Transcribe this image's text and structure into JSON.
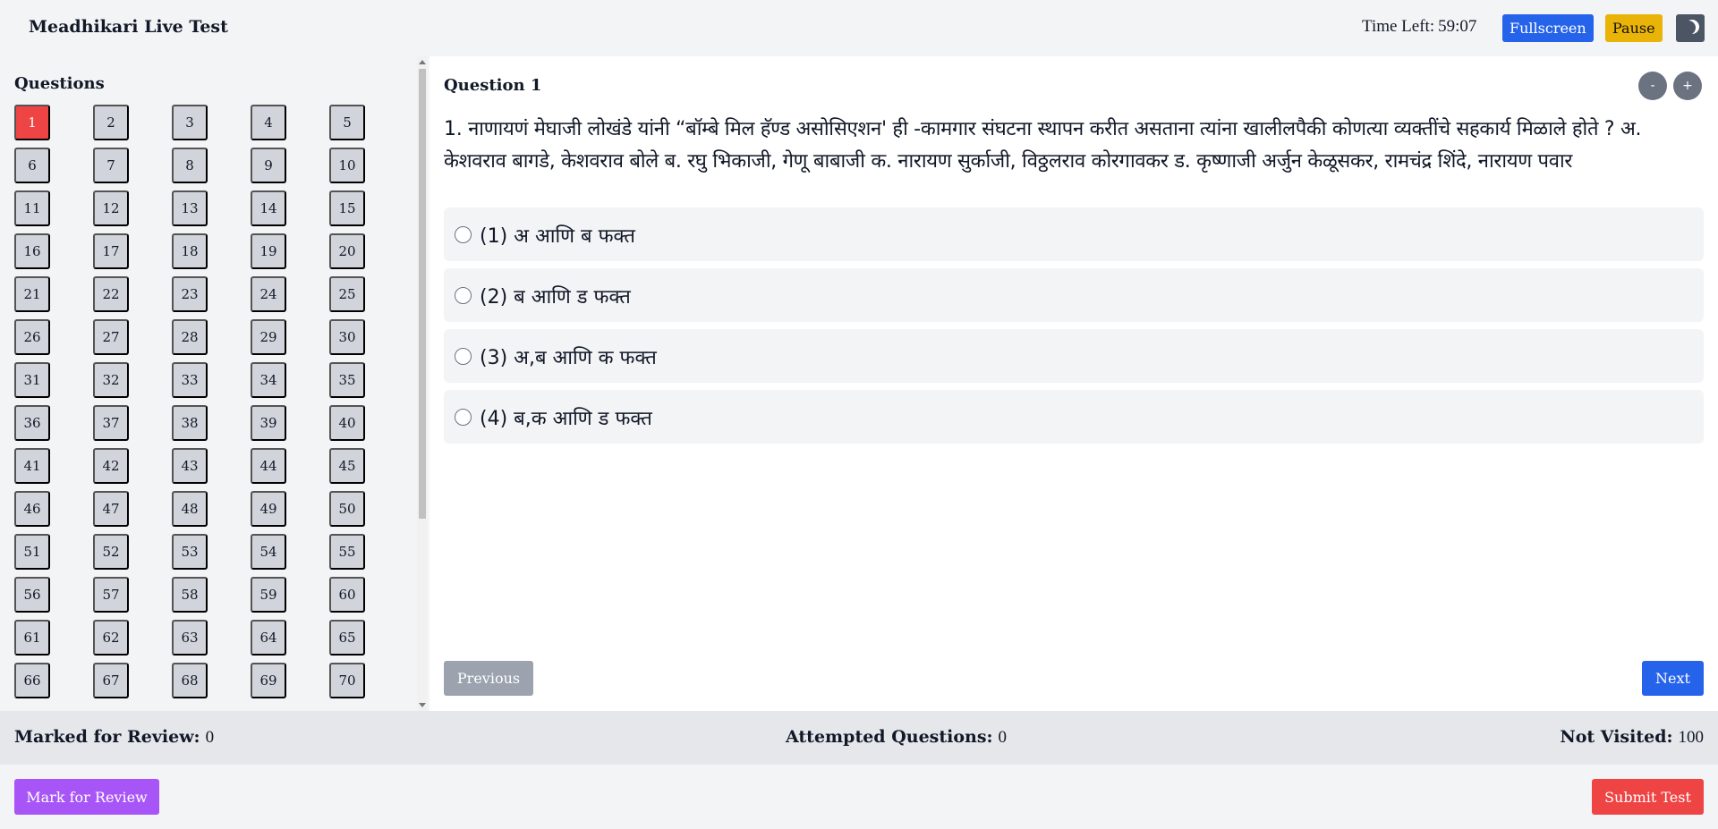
{
  "header": {
    "title": "Meadhikari Live Test",
    "time_label": "Time Left:",
    "time_value": "59:07",
    "fullscreen_label": "Fullscreen",
    "pause_label": "Pause",
    "theme_icon": "moon-icon"
  },
  "sidebar": {
    "heading": "Questions",
    "active_question": 1,
    "visible_question_numbers": [
      "1",
      "2",
      "3",
      "4",
      "5",
      "6",
      "7",
      "8",
      "9",
      "10",
      "11",
      "12",
      "13",
      "14",
      "15",
      "16",
      "17",
      "18",
      "19",
      "20",
      "21",
      "22",
      "23",
      "24",
      "25",
      "26",
      "27",
      "28",
      "29",
      "30",
      "31",
      "32",
      "33",
      "34",
      "35",
      "36",
      "37",
      "38",
      "39",
      "40",
      "41",
      "42",
      "43",
      "44",
      "45",
      "46",
      "47",
      "48",
      "49",
      "50",
      "51",
      "52",
      "53",
      "54",
      "55",
      "56",
      "57",
      "58",
      "59",
      "60",
      "61",
      "62",
      "63",
      "64",
      "65",
      "66",
      "67",
      "68",
      "69",
      "70"
    ]
  },
  "question": {
    "heading": "Question 1",
    "zoom_out_label": "-",
    "zoom_in_label": "+",
    "text": "1. नाणायणं मेघाजी लोखंडे यांनी “बॉम्बे मिल हॅण्ड असोसिएशन' ही -कामगार संघटना स्थापन करीत असताना त्यांना खालीलपैकी कोणत्या व्यक्तींचे सहकार्य मिळाले होते ? अ. केशवराव बागडे, केशवराव बोले ब. रघु भिकाजी, गेणू बाबाजी क. नारायण सुर्काजी, विठ्ठलराव कोरगावकर ड. कृष्णाजी अर्जुन केळूसकर, रामचंद्र शिंदे, नारायण पवार",
    "options": [
      {
        "label": "(1) अ आणि ब फक्त"
      },
      {
        "label": "(2) ब आणि ड फक्त"
      },
      {
        "label": "(3) अ,ब आणि क फक्त"
      },
      {
        "label": "(4) ब,क आणि ड फक्त"
      }
    ],
    "previous_label": "Previous",
    "next_label": "Next"
  },
  "status": {
    "marked_label": "Marked for Review:",
    "marked_value": "0",
    "attempted_label": "Attempted Questions:",
    "attempted_value": "0",
    "not_visited_label": "Not Visited:",
    "not_visited_value": "100"
  },
  "footer": {
    "mark_review_label": "Mark for Review",
    "submit_label": "Submit Test"
  },
  "colors": {
    "active_question": "#ef4444",
    "primary": "#2563eb",
    "pause": "#eab308",
    "mark_review": "#a855f7",
    "submit": "#ef4444"
  }
}
